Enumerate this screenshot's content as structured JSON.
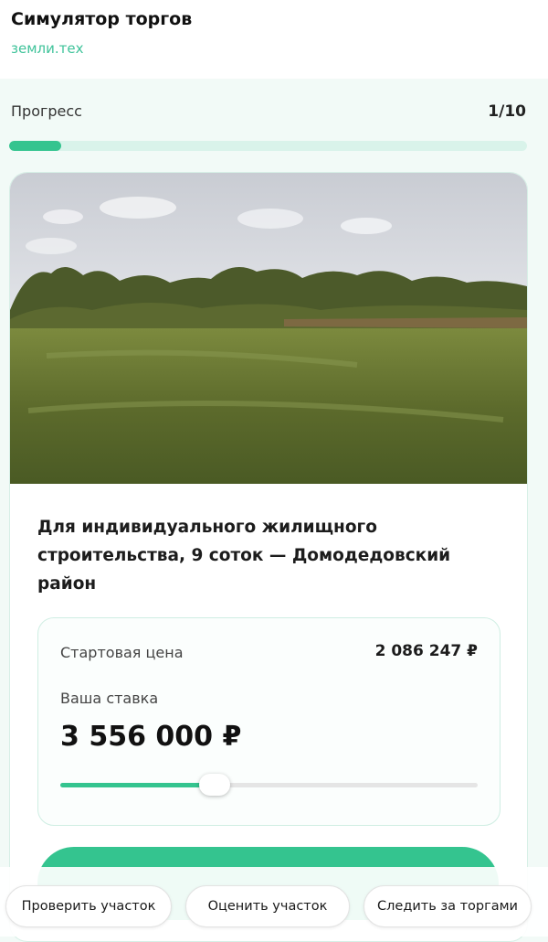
{
  "header": {
    "title": "Симулятор торгов",
    "subtitle": "земли.тех"
  },
  "progress": {
    "label": "Прогресс",
    "count": "1/10",
    "fraction": 0.1
  },
  "lot": {
    "photo_alt": "field-photo",
    "title": "Для индивидуального жилищного строительства, 9 соток — Домодедовский район",
    "start_label": "Стартовая цена",
    "start_price": "2 086 247 ₽",
    "bid_label": "Ваша ставка",
    "bid_value": "3 556 000 ₽",
    "slider_fraction": 0.37
  },
  "bottom_actions": [
    "Проверить участок",
    "Оценить участок",
    "Следить за торгами"
  ],
  "colors": {
    "accent": "#34c48f",
    "accent_light": "#d9f3ea",
    "link": "#3fc39a"
  }
}
